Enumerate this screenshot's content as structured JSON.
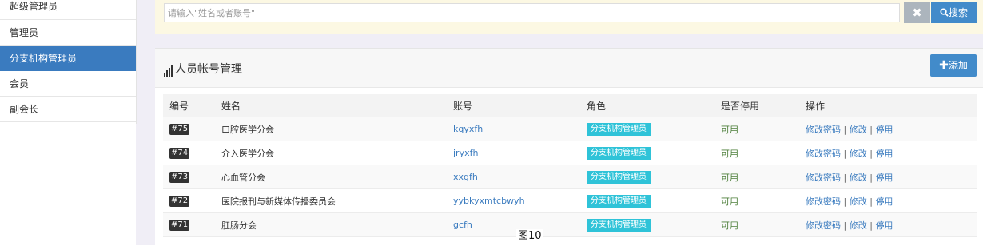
{
  "sidebar": {
    "items": [
      {
        "label": "超级管理员",
        "active": false
      },
      {
        "label": "管理员",
        "active": false
      },
      {
        "label": "分支机构管理员",
        "active": true
      },
      {
        "label": "会员",
        "active": false
      },
      {
        "label": "副会长",
        "active": false
      }
    ]
  },
  "search": {
    "placeholder": "请输入\"姓名或者账号\"",
    "clear_icon": "close-icon",
    "button_label": "搜索",
    "button_icon": "search-icon"
  },
  "panel": {
    "title": "人员帐号管理",
    "title_icon": "signal-bars-icon",
    "add_label": "添加",
    "add_icon": "plus-icon"
  },
  "table": {
    "headers": [
      "编号",
      "姓名",
      "账号",
      "角色",
      "是否停用",
      "操作"
    ],
    "rows": [
      {
        "id": "#75",
        "name": "口腔医学分会",
        "account": "kqyxfh",
        "role": "分支机构管理员",
        "status": "可用"
      },
      {
        "id": "#74",
        "name": "介入医学分会",
        "account": "jryxfh",
        "role": "分支机构管理员",
        "status": "可用"
      },
      {
        "id": "#73",
        "name": "心血管分会",
        "account": "xxgfh",
        "role": "分支机构管理员",
        "status": "可用"
      },
      {
        "id": "#72",
        "name": "医院报刊与新媒体传播委员会",
        "account": "yybkyxmtcbwyh",
        "role": "分支机构管理员",
        "status": "可用"
      },
      {
        "id": "#71",
        "name": "肛肠分会",
        "account": "gcfh",
        "role": "分支机构管理员",
        "status": "可用"
      }
    ],
    "actions": {
      "change_password": "修改密码",
      "edit": "修改",
      "disable": "停用",
      "separator": "|"
    }
  },
  "caption": "图10",
  "colors": {
    "primary": "#428bca",
    "active_sidebar": "#3a7bbf",
    "role_badge": "#2fc3d8",
    "id_badge": "#333333",
    "search_bg": "#fcf8e3"
  }
}
